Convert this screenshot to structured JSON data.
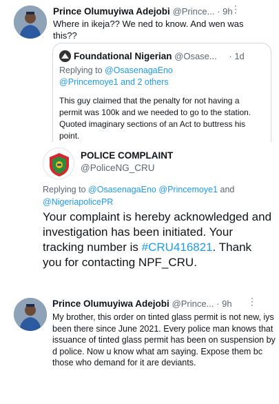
{
  "tweet1": {
    "author": "Prince Olumuyiwa Adejobi",
    "handle": "@Prince...",
    "time": "· 9h",
    "text": "Where in ikeja?? We ned to know. And wen was this??",
    "quote": {
      "author": "Foundational Nigerian",
      "handle": "@Osase...",
      "time": "· 1d",
      "replying_prefix": "Replying to ",
      "replying_to": "@OsasenagaEno",
      "replying_more": "@Princemoye1 and 2 others",
      "text": "This guy claimed that the penalty for not having a permit was 100k and we needed to go to the station. Quoted imaginary sections of an Act to buttress his point."
    }
  },
  "tweet2": {
    "author": "POLICE COMPLAINT",
    "handle": "@PoliceNG_CRU",
    "replying_prefix": "Replying to ",
    "replying_to_1": "@OsasenagaEno",
    "replying_to_2": "@Princemoye1",
    "replying_and": " and",
    "replying_to_3": "@NigeriapolicePR",
    "text_before": "Your complaint is hereby acknowledged and investigation has been initiated. Your tracking number is ",
    "hashtag": "#CRU416821",
    "text_after": ". Thank you for contacting NPF_CRU."
  },
  "tweet3": {
    "author": "Prince Olumuyiwa Adejobi",
    "handle": "@Prince...",
    "time": "· 9h",
    "text": "My brother,  this order on tinted glass permit is not new, iys been there since June 2021. Every police man knows that issuance of tinted glass permit has been on suspension by d police. Now u know what am saying. Expose them bc those who demand for it are deviants."
  },
  "icons": {
    "more": "more-icon",
    "nav_left": "chevron-left-icon",
    "nav_right": "chevron-right-icon",
    "logo": "police-complaint-logo"
  }
}
